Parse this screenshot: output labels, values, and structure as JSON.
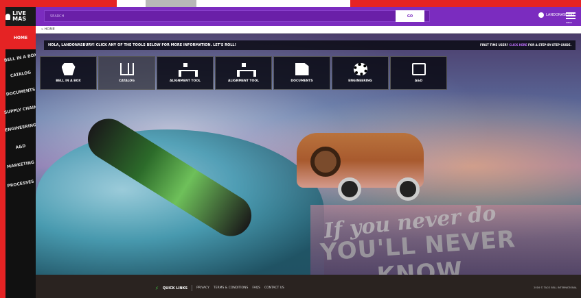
{
  "brand": {
    "logo_text": "LIVE MAS",
    "accent": "#7b2cbf",
    "sidebar_active": "#e52324"
  },
  "header": {
    "search_placeholder": "SEARCH",
    "search_button": "GO",
    "username": "LANDONASBURY",
    "menu_label": "MENU"
  },
  "breadcrumb": {
    "text": "» HOME"
  },
  "sidebar": {
    "items": [
      {
        "label": "HOME"
      },
      {
        "label": "BELL IN A BOX"
      },
      {
        "label": "CATALOG"
      },
      {
        "label": "DOCUMENTS"
      },
      {
        "label": "SUPPLY CHAIN"
      },
      {
        "label": "ENGINEERING"
      },
      {
        "label": "A&D"
      },
      {
        "label": "MARKETING"
      },
      {
        "label": "PROCESSES"
      }
    ]
  },
  "welcome": {
    "message": "HOLA, LANDONASBURY! CLICK ANY OF THE TOOLS BELOW FOR MORE INFORMATION. LET'S ROLL!",
    "tour_prefix": "FIRST TIME USER?",
    "tour_link": "CLICK HERE",
    "tour_suffix": "FOR A STEP-BY-STEP GUIDE."
  },
  "tools": [
    {
      "label": "BELL IN A BOX",
      "icon": "box-icon"
    },
    {
      "label": "CATALOG",
      "icon": "book-icon"
    },
    {
      "label": "ALIGNMENT TOOL",
      "icon": "org-chart-icon"
    },
    {
      "label": "ALIGNMENT TOOL",
      "icon": "org-chart-icon"
    },
    {
      "label": "DOCUMENTS",
      "icon": "document-icon"
    },
    {
      "label": "ENGINEERING",
      "icon": "engineering-gear-icon"
    },
    {
      "label": "A&D",
      "icon": "device-icon"
    }
  ],
  "hero": {
    "slogan_line1": "If you never do",
    "slogan_line2": "YOU'LL NEVER KNOW"
  },
  "footer": {
    "quick_links": "QUICK LINKS",
    "links": [
      "PRIVACY",
      "TERMS & CONDITIONS",
      "FAQS",
      "CONTACT US"
    ],
    "copyright": "2016 © TACO BELL INTERNATIONAL"
  }
}
